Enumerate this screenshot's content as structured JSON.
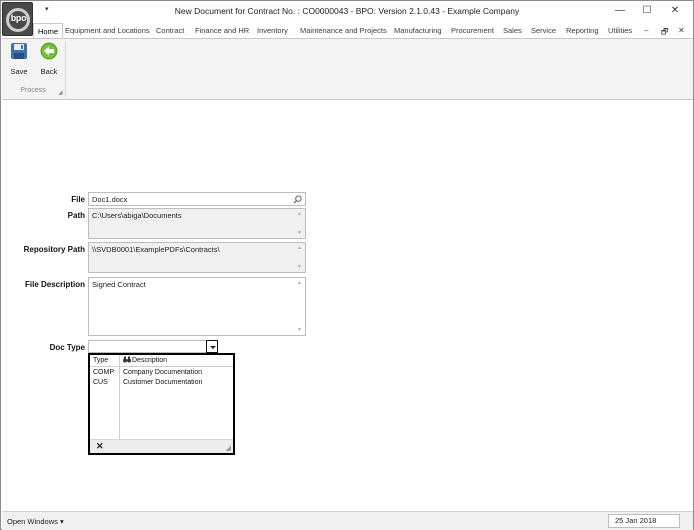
{
  "window": {
    "title": "New Document for Contract No. : CO0000043 - BPO: Version 2.1.0.43 - Example Company",
    "logo_text": "bpo",
    "qat_arrow": "▾",
    "controls": {
      "minimize": "—",
      "maximize": "☐",
      "close": "✕"
    }
  },
  "ribbon": {
    "tabs": [
      "Home",
      "Equipment and Locations",
      "Contract",
      "Finance and HR",
      "Inventory",
      "Maintenance and Projects",
      "Manufacturing",
      "Procurement",
      "Sales",
      "Service",
      "Reporting",
      "Utilities"
    ],
    "active_tab": "Home",
    "right_controls": {
      "minimize": "–",
      "restore": "🗗",
      "close": "✕"
    },
    "buttons": {
      "save": "Save",
      "back": "Back"
    },
    "group_label": "Process"
  },
  "form": {
    "file": {
      "label": "File",
      "value": "Doc1.docx"
    },
    "path": {
      "label": "Path",
      "value": "C:\\Users\\abiga\\Documents"
    },
    "repository_path": {
      "label": "Repository Path",
      "value": "\\\\SVDB0001\\ExamplePDFs\\Contracts\\"
    },
    "file_description": {
      "label": "File Description",
      "value": "Signed Contract"
    },
    "doc_type": {
      "label": "Doc Type",
      "value": ""
    }
  },
  "dropdown": {
    "columns": [
      "Type",
      "Description"
    ],
    "rows": [
      {
        "type": "COMP",
        "description": "Company Documentation"
      },
      {
        "type": "CUS",
        "description": "Customer Documentation"
      }
    ]
  },
  "statusbar": {
    "open_windows": "Open Windows ▾",
    "date": "25 Jan 2018"
  },
  "colors": {
    "ribbon_bg": "#f3f3f3",
    "back_green": "#5aa72a",
    "save_blue": "#3a6fb0"
  }
}
